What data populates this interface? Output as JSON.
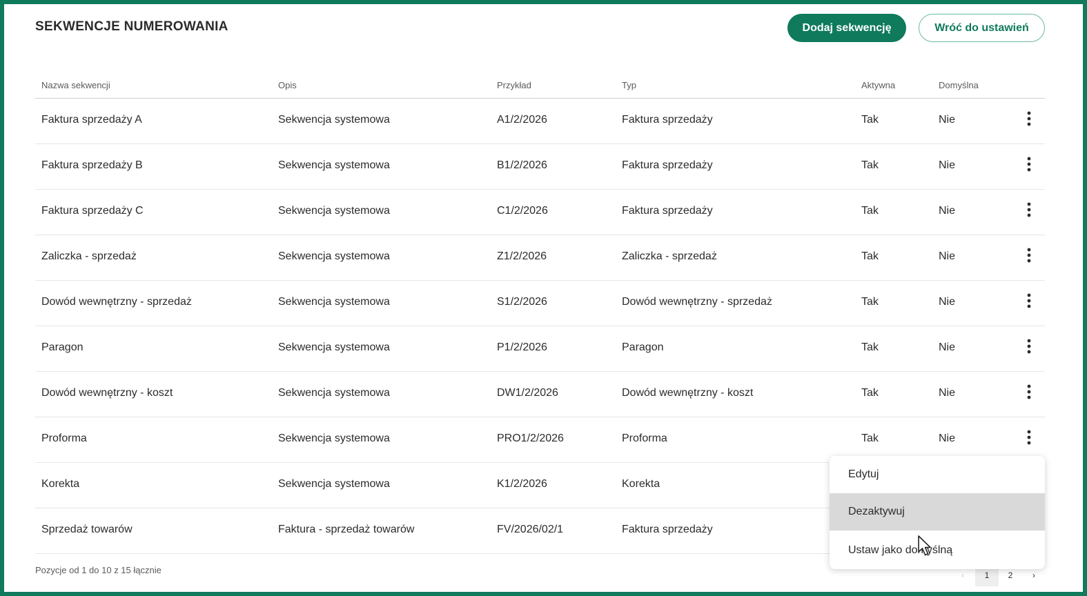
{
  "header": {
    "title": "SEKWENCJE NUMEROWANIA",
    "add_button": "Dodaj sekwencję",
    "back_button": "Wróć do ustawień"
  },
  "table": {
    "columns": {
      "name": "Nazwa sekwencji",
      "description": "Opis",
      "example": "Przykład",
      "type": "Typ",
      "active": "Aktywna",
      "default": "Domyślna"
    },
    "rows": [
      {
        "name": "Faktura sprzedaży A",
        "description": "Sekwencja systemowa",
        "example": "A1/2/2026",
        "type": "Faktura sprzedaży",
        "active": "Tak",
        "default": "Nie"
      },
      {
        "name": "Faktura sprzedaży B",
        "description": "Sekwencja systemowa",
        "example": "B1/2/2026",
        "type": "Faktura sprzedaży",
        "active": "Tak",
        "default": "Nie"
      },
      {
        "name": "Faktura sprzedaży C",
        "description": "Sekwencja systemowa",
        "example": "C1/2/2026",
        "type": "Faktura sprzedaży",
        "active": "Tak",
        "default": "Nie"
      },
      {
        "name": "Zaliczka - sprzedaż",
        "description": "Sekwencja systemowa",
        "example": "Z1/2/2026",
        "type": "Zaliczka - sprzedaż",
        "active": "Tak",
        "default": "Nie"
      },
      {
        "name": "Dowód wewnętrzny - sprzedaż",
        "description": "Sekwencja systemowa",
        "example": "S1/2/2026",
        "type": "Dowód wewnętrzny - sprzedaż",
        "active": "Tak",
        "default": "Nie"
      },
      {
        "name": "Paragon",
        "description": "Sekwencja systemowa",
        "example": "P1/2/2026",
        "type": "Paragon",
        "active": "Tak",
        "default": "Nie"
      },
      {
        "name": "Dowód wewnętrzny - koszt",
        "description": "Sekwencja systemowa",
        "example": "DW1/2/2026",
        "type": "Dowód wewnętrzny - koszt",
        "active": "Tak",
        "default": "Nie"
      },
      {
        "name": "Proforma",
        "description": "Sekwencja systemowa",
        "example": "PRO1/2/2026",
        "type": "Proforma",
        "active": "Tak",
        "default": "Nie"
      },
      {
        "name": "Korekta",
        "description": "Sekwencja systemowa",
        "example": "K1/2/2026",
        "type": "Korekta",
        "active": "",
        "default": ""
      },
      {
        "name": "Sprzedaż towarów",
        "description": "Faktura - sprzedaż towarów",
        "example": "FV/2026/02/1",
        "type": "Faktura sprzedaży",
        "active": "",
        "default": ""
      }
    ]
  },
  "footer": {
    "info": "Pozycje od 1 do 10 z 15 łącznie",
    "pages": [
      "1",
      "2"
    ],
    "current_page": "1",
    "prev_glyph": "‹",
    "next_glyph": "›"
  },
  "context_menu": {
    "items": [
      "Edytuj",
      "Dezaktywuj",
      "Ustaw jako domyślną"
    ],
    "highlighted": "Dezaktywuj"
  },
  "colors": {
    "accent": "#0f7a5c",
    "outline_border": "#6cb9a3",
    "highlight": "#d9d9d9"
  },
  "icons": {
    "row_menu": "more-vertical-icon",
    "cursor": "mouse-pointer-icon"
  }
}
